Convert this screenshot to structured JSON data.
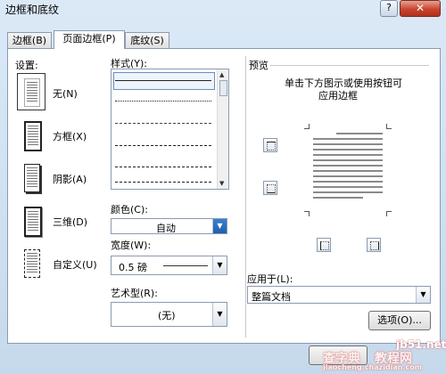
{
  "window": {
    "title": "边框和底纹",
    "help": "?",
    "close": "✕"
  },
  "tabs": [
    {
      "label": "边框(B)",
      "active": false
    },
    {
      "label": "页面边框(P)",
      "active": true
    },
    {
      "label": "底纹(S)",
      "active": false
    }
  ],
  "settings": {
    "heading": "设置:",
    "items": [
      {
        "label": "无(N)",
        "selected": true
      },
      {
        "label": "方框(X)",
        "selected": false
      },
      {
        "label": "阴影(A)",
        "selected": false
      },
      {
        "label": "三维(D)",
        "selected": false
      },
      {
        "label": "自定义(U)",
        "selected": false
      }
    ]
  },
  "style": {
    "heading": "样式(Y):",
    "up_arrow": "▲",
    "down_arrow": "▼"
  },
  "color": {
    "heading": "颜色(C):",
    "value": "自动",
    "drop": "▼"
  },
  "width": {
    "heading": "宽度(W):",
    "value": "0.5 磅",
    "drop": "▼"
  },
  "art": {
    "heading": "艺术型(R):",
    "value": "(无)",
    "drop": "▼"
  },
  "preview": {
    "heading": "预览",
    "hint_line1": "单击下方图示或使用按钮可",
    "hint_line2": "应用边框"
  },
  "apply_to": {
    "heading": "应用于(L):",
    "value": "整篇文档",
    "drop": "▼"
  },
  "buttons": {
    "options": "选项(O)..."
  },
  "watermark": {
    "site": "jb51.net",
    "tutorial": "教程网",
    "left": "查字典",
    "bottom": "jiaocheng.chazidian.com"
  }
}
